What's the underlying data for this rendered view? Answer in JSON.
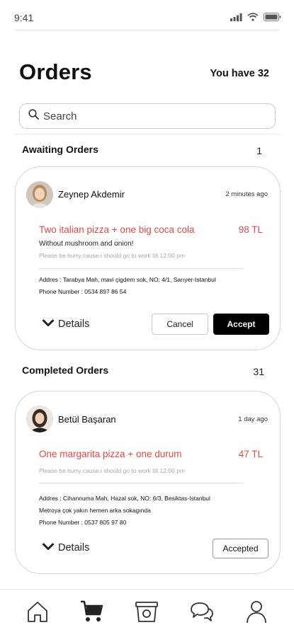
{
  "status_bar": {
    "time": "9:41"
  },
  "header": {
    "title": "Orders",
    "order_count_label": "You have 32"
  },
  "search": {
    "placeholder": "Search"
  },
  "awaiting": {
    "title": "Awaiting Orders",
    "count": "1",
    "order": {
      "customer": "Zeynep Akdemir",
      "time": "2 minutes ago",
      "title": "Two italian pizza + one big coca cola",
      "price": "98 TL",
      "note": "Without mushroom and onion!",
      "hint": "Please be hurry cause i should go to work till 12:00 pm",
      "address": "Addres : Tarabya Mah, mavi çigdem sok, NO: 4/1, Sarıyer-Istanbul",
      "phone": "Phone Number : 0534 897 86 54",
      "details_label": "Details",
      "cancel_label": "Cancel",
      "accept_label": "Accept"
    }
  },
  "completed": {
    "title": "Completed Orders",
    "count": "31",
    "order": {
      "customer": "Betül Başaran",
      "time": "1 day ago",
      "title": "One margarita pizza + one durum",
      "price": "47 TL",
      "hint": "Please be hurry cause i should go to work till 12:00 pm",
      "address": "Addres : Cihannuma Mah, Hazal sok, NO: 6/3, Besiktas-Istanbul",
      "address_note": "Metroya çok yakın hemen arka sokagında",
      "phone": "Phone Number : 0537 805 97 80",
      "details_label": "Details",
      "status_label": "Accepted"
    }
  },
  "bottom_nav": {
    "items": [
      {
        "icon": "home-icon"
      },
      {
        "icon": "cart-icon"
      },
      {
        "icon": "orders-icon"
      },
      {
        "icon": "chat-icon"
      },
      {
        "icon": "profile-icon"
      }
    ]
  },
  "colors": {
    "accent_red": "#e04848",
    "button_dark": "#000000",
    "border": "#d6d6d6"
  }
}
